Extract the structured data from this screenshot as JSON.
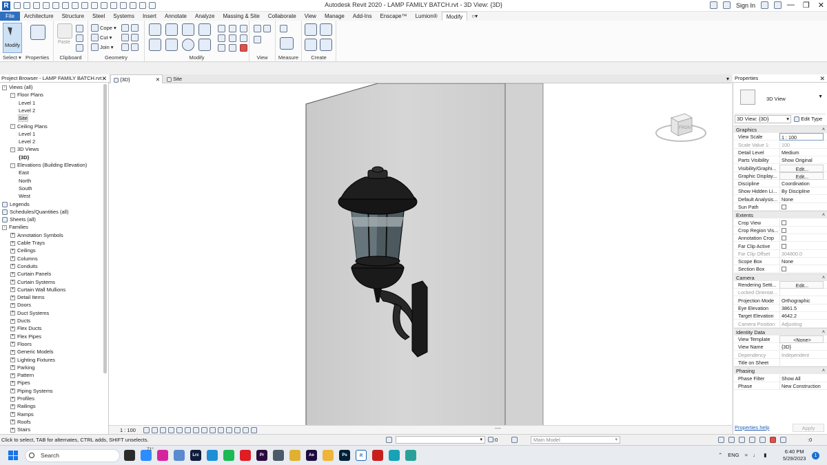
{
  "window": {
    "title": "Autodesk Revit 2020 - LAMP FAMILY BATCH.rvt - 3D View: {3D}",
    "sign_in": "Sign In"
  },
  "ribbon": {
    "tabs": [
      "File",
      "Architecture",
      "Structure",
      "Steel",
      "Systems",
      "Insert",
      "Annotate",
      "Analyze",
      "Massing & Site",
      "Collaborate",
      "View",
      "Manage",
      "Add-Ins",
      "Enscape™",
      "Lumion®",
      "Modify"
    ],
    "active_tab": "Modify",
    "modify_label": "Modify",
    "select_label": "Select",
    "properties_label": "Properties",
    "paste_label": "Paste",
    "clipboard_label": "Clipboard",
    "cope_label": "Cope",
    "cut_label": "Cut",
    "join_label": "Join",
    "geometry_label": "Geometry",
    "modify_group_label": "Modify",
    "view_group_label": "View",
    "measure_label": "Measure",
    "create_label": "Create"
  },
  "project_browser": {
    "title": "Project Browser - LAMP FAMILY BATCH.rvt",
    "items": [
      {
        "label": "Views (all)",
        "level": 0,
        "expander": "-"
      },
      {
        "label": "Floor Plans",
        "level": 1,
        "expander": "-"
      },
      {
        "label": "Level 1",
        "level": 2,
        "expander": ""
      },
      {
        "label": "Level 2",
        "level": 2,
        "expander": ""
      },
      {
        "label": "Site",
        "level": 2,
        "expander": "",
        "selected": true
      },
      {
        "label": "Ceiling Plans",
        "level": 1,
        "expander": "-"
      },
      {
        "label": "Level 1",
        "level": 2,
        "expander": ""
      },
      {
        "label": "Level 2",
        "level": 2,
        "expander": ""
      },
      {
        "label": "3D Views",
        "level": 1,
        "expander": "-"
      },
      {
        "label": "{3D}",
        "level": 2,
        "expander": "",
        "bold": true
      },
      {
        "label": "Elevations (Building Elevation)",
        "level": 1,
        "expander": "-"
      },
      {
        "label": "East",
        "level": 2,
        "expander": ""
      },
      {
        "label": "North",
        "level": 2,
        "expander": ""
      },
      {
        "label": "South",
        "level": 2,
        "expander": ""
      },
      {
        "label": "West",
        "level": 2,
        "expander": ""
      },
      {
        "label": "Legends",
        "level": 0,
        "expander": "",
        "icon": true
      },
      {
        "label": "Schedules/Quantities (all)",
        "level": 0,
        "expander": "",
        "icon": true
      },
      {
        "label": "Sheets (all)",
        "level": 0,
        "expander": "",
        "icon": true
      },
      {
        "label": "Families",
        "level": 0,
        "expander": "-"
      },
      {
        "label": "Annotation Symbols",
        "level": 1,
        "expander": "+"
      },
      {
        "label": "Cable Trays",
        "level": 1,
        "expander": "+"
      },
      {
        "label": "Ceilings",
        "level": 1,
        "expander": "+"
      },
      {
        "label": "Columns",
        "level": 1,
        "expander": "+"
      },
      {
        "label": "Conduits",
        "level": 1,
        "expander": "+"
      },
      {
        "label": "Curtain Panels",
        "level": 1,
        "expander": "+"
      },
      {
        "label": "Curtain Systems",
        "level": 1,
        "expander": "+"
      },
      {
        "label": "Curtain Wall Mullions",
        "level": 1,
        "expander": "+"
      },
      {
        "label": "Detail Items",
        "level": 1,
        "expander": "+"
      },
      {
        "label": "Doors",
        "level": 1,
        "expander": "+"
      },
      {
        "label": "Duct Systems",
        "level": 1,
        "expander": "+"
      },
      {
        "label": "Ducts",
        "level": 1,
        "expander": "+"
      },
      {
        "label": "Flex Ducts",
        "level": 1,
        "expander": "+"
      },
      {
        "label": "Flex Pipes",
        "level": 1,
        "expander": "+"
      },
      {
        "label": "Floors",
        "level": 1,
        "expander": "+"
      },
      {
        "label": "Generic Models",
        "level": 1,
        "expander": "+"
      },
      {
        "label": "Lighting Fixtures",
        "level": 1,
        "expander": "+"
      },
      {
        "label": "Parking",
        "level": 1,
        "expander": "+"
      },
      {
        "label": "Pattern",
        "level": 1,
        "expander": "+"
      },
      {
        "label": "Pipes",
        "level": 1,
        "expander": "+"
      },
      {
        "label": "Piping Systems",
        "level": 1,
        "expander": "+"
      },
      {
        "label": "Profiles",
        "level": 1,
        "expander": "+"
      },
      {
        "label": "Railings",
        "level": 1,
        "expander": "+"
      },
      {
        "label": "Ramps",
        "level": 1,
        "expander": "+"
      },
      {
        "label": "Roofs",
        "level": 1,
        "expander": "+"
      },
      {
        "label": "Stairs",
        "level": 1,
        "expander": "+"
      }
    ]
  },
  "view_tabs": [
    {
      "label": "{3D}",
      "active": true
    },
    {
      "label": "Site",
      "active": false
    }
  ],
  "viewcube": {
    "face_label": "FRONT"
  },
  "properties": {
    "title": "Properties",
    "type_name": "3D View",
    "instance_selector": "3D View: {3D}",
    "edit_type": "Edit Type",
    "sections": [
      {
        "name": "Graphics",
        "rows": [
          {
            "k": "View Scale",
            "v": "1 : 100",
            "kind": "sel"
          },
          {
            "k": "Scale Value    1:",
            "v": "100",
            "kind": "ro"
          },
          {
            "k": "Detail Level",
            "v": "Medium"
          },
          {
            "k": "Parts Visibility",
            "v": "Show Original"
          },
          {
            "k": "Visibility/Graphi...",
            "v": "Edit...",
            "kind": "btn"
          },
          {
            "k": "Graphic Display...",
            "v": "Edit...",
            "kind": "btn"
          },
          {
            "k": "Discipline",
            "v": "Coordination"
          },
          {
            "k": "Show Hidden Li...",
            "v": "By Discipline"
          },
          {
            "k": "Default Analysis...",
            "v": "None"
          },
          {
            "k": "Sun Path",
            "v": "",
            "kind": "chk"
          }
        ]
      },
      {
        "name": "Extents",
        "rows": [
          {
            "k": "Crop View",
            "v": "",
            "kind": "chk"
          },
          {
            "k": "Crop Region Vis...",
            "v": "",
            "kind": "chk"
          },
          {
            "k": "Annotation Crop",
            "v": "",
            "kind": "chk"
          },
          {
            "k": "Far Clip Active",
            "v": "",
            "kind": "chk"
          },
          {
            "k": "Far Clip Offset",
            "v": "304800.0",
            "kind": "ro"
          },
          {
            "k": "Scope Box",
            "v": "None"
          },
          {
            "k": "Section Box",
            "v": "",
            "kind": "chk"
          }
        ]
      },
      {
        "name": "Camera",
        "rows": [
          {
            "k": "Rendering Setti...",
            "v": "Edit...",
            "kind": "btn"
          },
          {
            "k": "Locked Orientat...",
            "v": "",
            "kind": "ro"
          },
          {
            "k": "Projection Mode",
            "v": "Orthographic"
          },
          {
            "k": "Eye Elevation",
            "v": "3861.5"
          },
          {
            "k": "Target Elevation",
            "v": "4642.2"
          },
          {
            "k": "Camera Position",
            "v": "Adjusting",
            "kind": "ro"
          }
        ]
      },
      {
        "name": "Identity Data",
        "rows": [
          {
            "k": "View Template",
            "v": "<None>",
            "kind": "btn"
          },
          {
            "k": "View Name",
            "v": "{3D}"
          },
          {
            "k": "Dependency",
            "v": "Independent",
            "kind": "ro"
          },
          {
            "k": "Title on Sheet",
            "v": ""
          }
        ]
      },
      {
        "name": "Phasing",
        "rows": [
          {
            "k": "Phase Filter",
            "v": "Show All"
          },
          {
            "k": "Phase",
            "v": "New Construction"
          }
        ]
      }
    ],
    "help_link": "Properties help",
    "apply_label": "Apply"
  },
  "view_control": {
    "scale": "1 : 100"
  },
  "status_bar": {
    "message": "Click to select, TAB for alternates, CTRL adds, SHIFT unselects.",
    "workset_value": ":0",
    "model_selector": "Main Model",
    "filter_count": ":0"
  },
  "taskbar": {
    "search_placeholder": "Search",
    "weather": "71°",
    "language": "ENG",
    "time": "6:40 PM",
    "date": "5/29/2023",
    "notification_count": "1",
    "apps": [
      {
        "name": "file-explorer-app",
        "color": "#2b2b2b",
        "label": ""
      },
      {
        "name": "zoom-app",
        "color": "#2d8cff",
        "label": ""
      },
      {
        "name": "instagram-app",
        "color": "#d6249f",
        "label": ""
      },
      {
        "name": "photos-app",
        "color": "#5a8ad0",
        "label": ""
      },
      {
        "name": "lightroom-app",
        "color": "#0d1c3b",
        "label": "Lrc"
      },
      {
        "name": "edge-app",
        "color": "#1e8fd6",
        "label": ""
      },
      {
        "name": "spotify-app",
        "color": "#1db954",
        "label": ""
      },
      {
        "name": "opera-app",
        "color": "#e01c24",
        "label": ""
      },
      {
        "name": "premiere-app",
        "color": "#2a0a3d",
        "label": "Pr"
      },
      {
        "name": "app-gray",
        "color": "#4a5a6a",
        "label": ""
      },
      {
        "name": "app-yellow",
        "color": "#e0b030",
        "label": ""
      },
      {
        "name": "after-effects-app",
        "color": "#1c0a3d",
        "label": "Ae"
      },
      {
        "name": "folder-app",
        "color": "#f0b43a",
        "label": ""
      },
      {
        "name": "photoshop-app",
        "color": "#001e36",
        "label": "Ps"
      },
      {
        "name": "revit-app",
        "color": "#ffffff",
        "label": "R"
      },
      {
        "name": "acrobat-app",
        "color": "#c81e1e",
        "label": ""
      },
      {
        "name": "app-teal",
        "color": "#17a2b8",
        "label": ""
      },
      {
        "name": "app-green",
        "color": "#2aa198",
        "label": ""
      }
    ]
  }
}
